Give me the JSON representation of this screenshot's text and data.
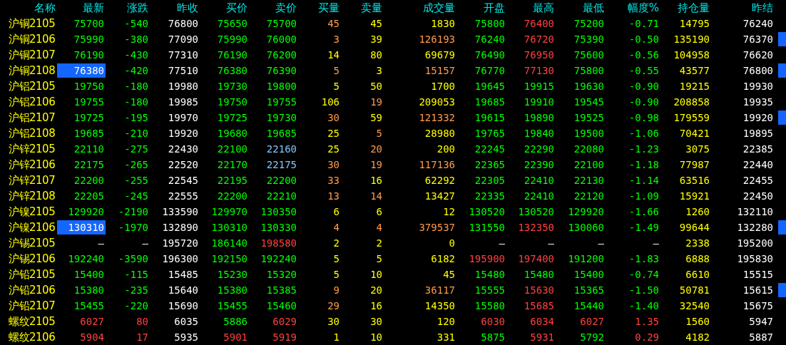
{
  "columns": [
    "名称",
    "最新",
    "涨跌",
    "昨收",
    "买价",
    "卖价",
    "买量",
    "卖量",
    "成交量",
    "开盘",
    "最高",
    "最低",
    "幅度%",
    "持仓量",
    "昨结"
  ],
  "rows": [
    {
      "name": "沪铜2105",
      "highlighted": false,
      "flagged": false,
      "cells": [
        {
          "text": "75700",
          "color": "#00ff00"
        },
        {
          "text": "-540",
          "color": "#00ff00"
        },
        {
          "text": "76800",
          "color": "#ffffff"
        },
        {
          "text": "75650",
          "color": "#00ff00"
        },
        {
          "text": "75700",
          "color": "#00ff00"
        },
        {
          "text": "45",
          "color": "#ff9a4a"
        },
        {
          "text": "45",
          "color": "#ffff00"
        },
        {
          "text": "1830",
          "color": "#ffff00"
        },
        {
          "text": "75800",
          "color": "#00ff00"
        },
        {
          "text": "76400",
          "color": "#ff4040"
        },
        {
          "text": "75200",
          "color": "#00ff00"
        },
        {
          "text": "-0.71",
          "color": "#00ff00"
        },
        {
          "text": "14795",
          "color": "#ffff00"
        },
        {
          "text": "76240",
          "color": "#ffffff"
        }
      ]
    },
    {
      "name": "沪铜2106",
      "highlighted": false,
      "flagged": true,
      "cells": [
        {
          "text": "75990",
          "color": "#00ff00"
        },
        {
          "text": "-380",
          "color": "#00ff00"
        },
        {
          "text": "77090",
          "color": "#ffffff"
        },
        {
          "text": "75990",
          "color": "#00ff00"
        },
        {
          "text": "76000",
          "color": "#00ff00"
        },
        {
          "text": "3",
          "color": "#ff9a4a"
        },
        {
          "text": "39",
          "color": "#ffff00"
        },
        {
          "text": "126193",
          "color": "#ff9a4a"
        },
        {
          "text": "76240",
          "color": "#00ff00"
        },
        {
          "text": "76720",
          "color": "#ff4040"
        },
        {
          "text": "75390",
          "color": "#00ff00"
        },
        {
          "text": "-0.50",
          "color": "#00ff00"
        },
        {
          "text": "135190",
          "color": "#ffff00"
        },
        {
          "text": "76370",
          "color": "#ffffff"
        }
      ]
    },
    {
      "name": "沪铜2107",
      "highlighted": false,
      "flagged": false,
      "cells": [
        {
          "text": "76190",
          "color": "#00ff00"
        },
        {
          "text": "-430",
          "color": "#00ff00"
        },
        {
          "text": "77310",
          "color": "#ffffff"
        },
        {
          "text": "76190",
          "color": "#00ff00"
        },
        {
          "text": "76200",
          "color": "#00ff00"
        },
        {
          "text": "14",
          "color": "#ffff00"
        },
        {
          "text": "80",
          "color": "#ffff00"
        },
        {
          "text": "69679",
          "color": "#ffff00"
        },
        {
          "text": "76490",
          "color": "#00ff00"
        },
        {
          "text": "76950",
          "color": "#ff4040"
        },
        {
          "text": "75600",
          "color": "#00ff00"
        },
        {
          "text": "-0.56",
          "color": "#00ff00"
        },
        {
          "text": "104958",
          "color": "#ffff00"
        },
        {
          "text": "76620",
          "color": "#ffffff"
        }
      ]
    },
    {
      "name": "沪铜2108",
      "highlighted": true,
      "flagged": true,
      "cells": [
        {
          "text": "76380",
          "color": "#ffffff"
        },
        {
          "text": "-420",
          "color": "#00ff00"
        },
        {
          "text": "77510",
          "color": "#ffffff"
        },
        {
          "text": "76380",
          "color": "#00ff00"
        },
        {
          "text": "76390",
          "color": "#00ff00"
        },
        {
          "text": "5",
          "color": "#ff9a4a"
        },
        {
          "text": "3",
          "color": "#ffff00"
        },
        {
          "text": "15157",
          "color": "#ff9a4a"
        },
        {
          "text": "76770",
          "color": "#00ff00"
        },
        {
          "text": "77130",
          "color": "#ff4040"
        },
        {
          "text": "75800",
          "color": "#00ff00"
        },
        {
          "text": "-0.55",
          "color": "#00ff00"
        },
        {
          "text": "43577",
          "color": "#ffff00"
        },
        {
          "text": "76800",
          "color": "#ffffff"
        }
      ]
    },
    {
      "name": "沪铝2105",
      "highlighted": false,
      "flagged": false,
      "cells": [
        {
          "text": "19750",
          "color": "#00ff00"
        },
        {
          "text": "-180",
          "color": "#00ff00"
        },
        {
          "text": "19980",
          "color": "#ffffff"
        },
        {
          "text": "19730",
          "color": "#00ff00"
        },
        {
          "text": "19800",
          "color": "#00ff00"
        },
        {
          "text": "5",
          "color": "#ffff00"
        },
        {
          "text": "50",
          "color": "#ffff00"
        },
        {
          "text": "1700",
          "color": "#ffff00"
        },
        {
          "text": "19645",
          "color": "#00ff00"
        },
        {
          "text": "19915",
          "color": "#00ff00"
        },
        {
          "text": "19630",
          "color": "#00ff00"
        },
        {
          "text": "-0.90",
          "color": "#00ff00"
        },
        {
          "text": "19215",
          "color": "#ffff00"
        },
        {
          "text": "19930",
          "color": "#ffffff"
        }
      ]
    },
    {
      "name": "沪铝2106",
      "highlighted": false,
      "flagged": false,
      "cells": [
        {
          "text": "19755",
          "color": "#00ff00"
        },
        {
          "text": "-180",
          "color": "#00ff00"
        },
        {
          "text": "19985",
          "color": "#ffffff"
        },
        {
          "text": "19750",
          "color": "#00ff00"
        },
        {
          "text": "19755",
          "color": "#00ff00"
        },
        {
          "text": "106",
          "color": "#ffff00"
        },
        {
          "text": "19",
          "color": "#ff9a4a"
        },
        {
          "text": "209053",
          "color": "#ffff00"
        },
        {
          "text": "19685",
          "color": "#00ff00"
        },
        {
          "text": "19910",
          "color": "#00ff00"
        },
        {
          "text": "19545",
          "color": "#00ff00"
        },
        {
          "text": "-0.90",
          "color": "#00ff00"
        },
        {
          "text": "208858",
          "color": "#ffff00"
        },
        {
          "text": "19935",
          "color": "#ffffff"
        }
      ]
    },
    {
      "name": "沪铝2107",
      "highlighted": false,
      "flagged": true,
      "cells": [
        {
          "text": "19725",
          "color": "#00ff00"
        },
        {
          "text": "-195",
          "color": "#00ff00"
        },
        {
          "text": "19970",
          "color": "#ffffff"
        },
        {
          "text": "19725",
          "color": "#00ff00"
        },
        {
          "text": "19730",
          "color": "#00ff00"
        },
        {
          "text": "30",
          "color": "#ff9a4a"
        },
        {
          "text": "59",
          "color": "#ffff00"
        },
        {
          "text": "121332",
          "color": "#ff9a4a"
        },
        {
          "text": "19615",
          "color": "#00ff00"
        },
        {
          "text": "19890",
          "color": "#00ff00"
        },
        {
          "text": "19525",
          "color": "#00ff00"
        },
        {
          "text": "-0.98",
          "color": "#00ff00"
        },
        {
          "text": "179559",
          "color": "#ffff00"
        },
        {
          "text": "19920",
          "color": "#ffffff"
        }
      ]
    },
    {
      "name": "沪铝2108",
      "highlighted": false,
      "flagged": false,
      "cells": [
        {
          "text": "19685",
          "color": "#00ff00"
        },
        {
          "text": "-210",
          "color": "#00ff00"
        },
        {
          "text": "19920",
          "color": "#ffffff"
        },
        {
          "text": "19680",
          "color": "#00ff00"
        },
        {
          "text": "19685",
          "color": "#00ff00"
        },
        {
          "text": "25",
          "color": "#ffff00"
        },
        {
          "text": "5",
          "color": "#ff9a4a"
        },
        {
          "text": "28980",
          "color": "#ffff00"
        },
        {
          "text": "19765",
          "color": "#00ff00"
        },
        {
          "text": "19840",
          "color": "#00ff00"
        },
        {
          "text": "19500",
          "color": "#00ff00"
        },
        {
          "text": "-1.06",
          "color": "#00ff00"
        },
        {
          "text": "70421",
          "color": "#ffff00"
        },
        {
          "text": "19895",
          "color": "#ffffff"
        }
      ]
    },
    {
      "name": "沪锌2105",
      "highlighted": false,
      "flagged": false,
      "cells": [
        {
          "text": "22110",
          "color": "#00ff00"
        },
        {
          "text": "-275",
          "color": "#00ff00"
        },
        {
          "text": "22430",
          "color": "#ffffff"
        },
        {
          "text": "22100",
          "color": "#00ff00"
        },
        {
          "text": "22160",
          "color": "#80c8ff"
        },
        {
          "text": "25",
          "color": "#ffff00"
        },
        {
          "text": "20",
          "color": "#ff9a4a"
        },
        {
          "text": "200",
          "color": "#ffff00"
        },
        {
          "text": "22245",
          "color": "#00ff00"
        },
        {
          "text": "22290",
          "color": "#00ff00"
        },
        {
          "text": "22080",
          "color": "#00ff00"
        },
        {
          "text": "-1.23",
          "color": "#00ff00"
        },
        {
          "text": "3075",
          "color": "#ffff00"
        },
        {
          "text": "22385",
          "color": "#ffffff"
        }
      ]
    },
    {
      "name": "沪锌2106",
      "highlighted": false,
      "flagged": false,
      "cells": [
        {
          "text": "22175",
          "color": "#00ff00"
        },
        {
          "text": "-265",
          "color": "#00ff00"
        },
        {
          "text": "22520",
          "color": "#ffffff"
        },
        {
          "text": "22170",
          "color": "#00ff00"
        },
        {
          "text": "22175",
          "color": "#80c8ff"
        },
        {
          "text": "30",
          "color": "#ff9a4a"
        },
        {
          "text": "19",
          "color": "#ff9a4a"
        },
        {
          "text": "117136",
          "color": "#ff9a4a"
        },
        {
          "text": "22365",
          "color": "#00ff00"
        },
        {
          "text": "22390",
          "color": "#00ff00"
        },
        {
          "text": "22100",
          "color": "#00ff00"
        },
        {
          "text": "-1.18",
          "color": "#00ff00"
        },
        {
          "text": "77987",
          "color": "#ffff00"
        },
        {
          "text": "22440",
          "color": "#ffffff"
        }
      ]
    },
    {
      "name": "沪锌2107",
      "highlighted": false,
      "flagged": false,
      "cells": [
        {
          "text": "22200",
          "color": "#00ff00"
        },
        {
          "text": "-255",
          "color": "#00ff00"
        },
        {
          "text": "22545",
          "color": "#ffffff"
        },
        {
          "text": "22195",
          "color": "#00ff00"
        },
        {
          "text": "22200",
          "color": "#00ff00"
        },
        {
          "text": "33",
          "color": "#ff9a4a"
        },
        {
          "text": "16",
          "color": "#ffff00"
        },
        {
          "text": "62292",
          "color": "#ffff00"
        },
        {
          "text": "22305",
          "color": "#00ff00"
        },
        {
          "text": "22410",
          "color": "#00ff00"
        },
        {
          "text": "22130",
          "color": "#00ff00"
        },
        {
          "text": "-1.14",
          "color": "#00ff00"
        },
        {
          "text": "63516",
          "color": "#ffff00"
        },
        {
          "text": "22455",
          "color": "#ffffff"
        }
      ]
    },
    {
      "name": "沪锌2108",
      "highlighted": false,
      "flagged": false,
      "cells": [
        {
          "text": "22205",
          "color": "#00ff00"
        },
        {
          "text": "-245",
          "color": "#00ff00"
        },
        {
          "text": "22555",
          "color": "#ffffff"
        },
        {
          "text": "22200",
          "color": "#00ff00"
        },
        {
          "text": "22210",
          "color": "#00ff00"
        },
        {
          "text": "13",
          "color": "#ff9a4a"
        },
        {
          "text": "14",
          "color": "#ff9a4a"
        },
        {
          "text": "13427",
          "color": "#ffff00"
        },
        {
          "text": "22335",
          "color": "#00ff00"
        },
        {
          "text": "22410",
          "color": "#00ff00"
        },
        {
          "text": "22120",
          "color": "#00ff00"
        },
        {
          "text": "-1.09",
          "color": "#00ff00"
        },
        {
          "text": "15921",
          "color": "#ffff00"
        },
        {
          "text": "22450",
          "color": "#ffffff"
        }
      ]
    },
    {
      "name": "沪镍2105",
      "highlighted": false,
      "flagged": false,
      "cells": [
        {
          "text": "129920",
          "color": "#00ff00"
        },
        {
          "text": "-2190",
          "color": "#00ff00"
        },
        {
          "text": "133590",
          "color": "#ffffff"
        },
        {
          "text": "129970",
          "color": "#00ff00"
        },
        {
          "text": "130350",
          "color": "#00ff00"
        },
        {
          "text": "6",
          "color": "#ffff00"
        },
        {
          "text": "6",
          "color": "#ffff00"
        },
        {
          "text": "12",
          "color": "#ffff00"
        },
        {
          "text": "130520",
          "color": "#00ff00"
        },
        {
          "text": "130520",
          "color": "#00ff00"
        },
        {
          "text": "129920",
          "color": "#00ff00"
        },
        {
          "text": "-1.66",
          "color": "#00ff00"
        },
        {
          "text": "1260",
          "color": "#ffff00"
        },
        {
          "text": "132110",
          "color": "#ffffff"
        }
      ]
    },
    {
      "name": "沪镍2106",
      "highlighted": true,
      "flagged": true,
      "cells": [
        {
          "text": "130310",
          "color": "#ffffff"
        },
        {
          "text": "-1970",
          "color": "#00ff00"
        },
        {
          "text": "132890",
          "color": "#ffffff"
        },
        {
          "text": "130310",
          "color": "#00ff00"
        },
        {
          "text": "130330",
          "color": "#00ff00"
        },
        {
          "text": "4",
          "color": "#ff9a4a"
        },
        {
          "text": "4",
          "color": "#ff9a4a"
        },
        {
          "text": "379537",
          "color": "#ff9a4a"
        },
        {
          "text": "131550",
          "color": "#00ff00"
        },
        {
          "text": "132350",
          "color": "#ff4040"
        },
        {
          "text": "130060",
          "color": "#00ff00"
        },
        {
          "text": "-1.49",
          "color": "#00ff00"
        },
        {
          "text": "99644",
          "color": "#ffff00"
        },
        {
          "text": "132280",
          "color": "#ffffff"
        }
      ]
    },
    {
      "name": "沪锡2105",
      "highlighted": false,
      "flagged": false,
      "cells": [
        {
          "text": "—",
          "color": "#ffffff"
        },
        {
          "text": "—",
          "color": "#ffffff"
        },
        {
          "text": "195720",
          "color": "#ffffff"
        },
        {
          "text": "186140",
          "color": "#00ff00"
        },
        {
          "text": "198580",
          "color": "#ff4040"
        },
        {
          "text": "2",
          "color": "#ffff00"
        },
        {
          "text": "2",
          "color": "#ffff00"
        },
        {
          "text": "0",
          "color": "#ffff00"
        },
        {
          "text": "—",
          "color": "#ffffff"
        },
        {
          "text": "—",
          "color": "#ffffff"
        },
        {
          "text": "—",
          "color": "#ffffff"
        },
        {
          "text": "—",
          "color": "#ffffff"
        },
        {
          "text": "2338",
          "color": "#ffff00"
        },
        {
          "text": "195200",
          "color": "#ffffff"
        }
      ]
    },
    {
      "name": "沪锡2106",
      "highlighted": false,
      "flagged": false,
      "cells": [
        {
          "text": "192240",
          "color": "#00ff00"
        },
        {
          "text": "-3590",
          "color": "#00ff00"
        },
        {
          "text": "196300",
          "color": "#ffffff"
        },
        {
          "text": "192150",
          "color": "#00ff00"
        },
        {
          "text": "192240",
          "color": "#00ff00"
        },
        {
          "text": "5",
          "color": "#ffff00"
        },
        {
          "text": "5",
          "color": "#ffff00"
        },
        {
          "text": "6182",
          "color": "#ffff00"
        },
        {
          "text": "195900",
          "color": "#ff4040"
        },
        {
          "text": "197400",
          "color": "#ff4040"
        },
        {
          "text": "191200",
          "color": "#00ff00"
        },
        {
          "text": "-1.83",
          "color": "#00ff00"
        },
        {
          "text": "6888",
          "color": "#ffff00"
        },
        {
          "text": "195830",
          "color": "#ffffff"
        }
      ]
    },
    {
      "name": "沪铅2105",
      "highlighted": false,
      "flagged": false,
      "cells": [
        {
          "text": "15400",
          "color": "#00ff00"
        },
        {
          "text": "-115",
          "color": "#00ff00"
        },
        {
          "text": "15485",
          "color": "#ffffff"
        },
        {
          "text": "15230",
          "color": "#00ff00"
        },
        {
          "text": "15320",
          "color": "#00ff00"
        },
        {
          "text": "5",
          "color": "#ffff00"
        },
        {
          "text": "10",
          "color": "#ffff00"
        },
        {
          "text": "45",
          "color": "#ffff00"
        },
        {
          "text": "15480",
          "color": "#00ff00"
        },
        {
          "text": "15480",
          "color": "#00ff00"
        },
        {
          "text": "15400",
          "color": "#00ff00"
        },
        {
          "text": "-0.74",
          "color": "#00ff00"
        },
        {
          "text": "6610",
          "color": "#ffff00"
        },
        {
          "text": "15515",
          "color": "#ffffff"
        }
      ]
    },
    {
      "name": "沪铅2106",
      "highlighted": false,
      "flagged": true,
      "cells": [
        {
          "text": "15380",
          "color": "#00ff00"
        },
        {
          "text": "-235",
          "color": "#00ff00"
        },
        {
          "text": "15640",
          "color": "#ffffff"
        },
        {
          "text": "15380",
          "color": "#00ff00"
        },
        {
          "text": "15385",
          "color": "#00ff00"
        },
        {
          "text": "9",
          "color": "#ff9a4a"
        },
        {
          "text": "20",
          "color": "#ffff00"
        },
        {
          "text": "36117",
          "color": "#ff9a4a"
        },
        {
          "text": "15555",
          "color": "#00ff00"
        },
        {
          "text": "15630",
          "color": "#ff4040"
        },
        {
          "text": "15365",
          "color": "#00ff00"
        },
        {
          "text": "-1.50",
          "color": "#00ff00"
        },
        {
          "text": "50781",
          "color": "#ffff00"
        },
        {
          "text": "15615",
          "color": "#ffffff"
        }
      ]
    },
    {
      "name": "沪铅2107",
      "highlighted": false,
      "flagged": false,
      "cells": [
        {
          "text": "15455",
          "color": "#00ff00"
        },
        {
          "text": "-220",
          "color": "#00ff00"
        },
        {
          "text": "15690",
          "color": "#ffffff"
        },
        {
          "text": "15455",
          "color": "#00ff00"
        },
        {
          "text": "15460",
          "color": "#00ff00"
        },
        {
          "text": "29",
          "color": "#ff9a4a"
        },
        {
          "text": "16",
          "color": "#ffff00"
        },
        {
          "text": "14350",
          "color": "#ffff00"
        },
        {
          "text": "15580",
          "color": "#00ff00"
        },
        {
          "text": "15685",
          "color": "#ff4040"
        },
        {
          "text": "15440",
          "color": "#00ff00"
        },
        {
          "text": "-1.40",
          "color": "#00ff00"
        },
        {
          "text": "32540",
          "color": "#ffff00"
        },
        {
          "text": "15675",
          "color": "#ffffff"
        }
      ]
    },
    {
      "name": "螺纹2105",
      "highlighted": false,
      "flagged": false,
      "cells": [
        {
          "text": "6027",
          "color": "#ff4040"
        },
        {
          "text": "80",
          "color": "#ff4040"
        },
        {
          "text": "6035",
          "color": "#ffffff"
        },
        {
          "text": "5886",
          "color": "#00ff00"
        },
        {
          "text": "6029",
          "color": "#ff4040"
        },
        {
          "text": "30",
          "color": "#ffff00"
        },
        {
          "text": "30",
          "color": "#ffff00"
        },
        {
          "text": "120",
          "color": "#ffff00"
        },
        {
          "text": "6030",
          "color": "#ff4040"
        },
        {
          "text": "6034",
          "color": "#ff4040"
        },
        {
          "text": "6027",
          "color": "#ff4040"
        },
        {
          "text": "1.35",
          "color": "#ff4040"
        },
        {
          "text": "1560",
          "color": "#ffff00"
        },
        {
          "text": "5947",
          "color": "#ffffff"
        }
      ]
    },
    {
      "name": "螺纹2106",
      "highlighted": false,
      "flagged": false,
      "cells": [
        {
          "text": "5904",
          "color": "#ff4040"
        },
        {
          "text": "17",
          "color": "#ff4040"
        },
        {
          "text": "5935",
          "color": "#ffffff"
        },
        {
          "text": "5901",
          "color": "#ff4040"
        },
        {
          "text": "5919",
          "color": "#ff4040"
        },
        {
          "text": "1",
          "color": "#ffff00"
        },
        {
          "text": "10",
          "color": "#ffff00"
        },
        {
          "text": "331",
          "color": "#ffff00"
        },
        {
          "text": "5875",
          "color": "#00ff00"
        },
        {
          "text": "5931",
          "color": "#ff4040"
        },
        {
          "text": "5792",
          "color": "#00ff00"
        },
        {
          "text": "0.29",
          "color": "#ff4040"
        },
        {
          "text": "4182",
          "color": "#ffff00"
        },
        {
          "text": "5887",
          "color": "#ffffff"
        }
      ]
    }
  ]
}
